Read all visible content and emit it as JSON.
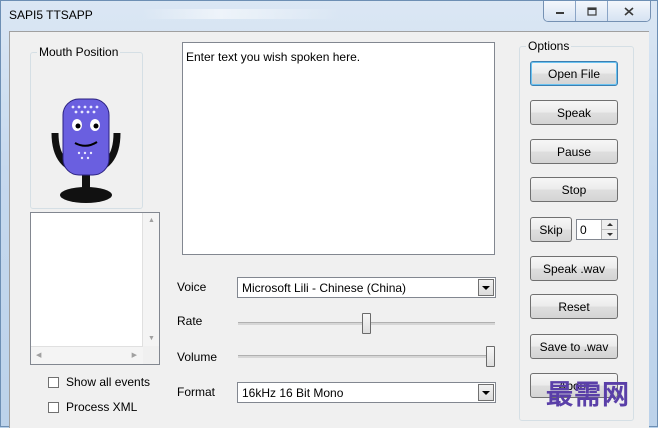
{
  "window": {
    "title": "SAPI5 TTSAPP"
  },
  "mouth_position": {
    "legend": "Mouth Position"
  },
  "text_input": {
    "value": "Enter text you wish spoken here."
  },
  "events_panel": {
    "show_all_events": {
      "label": "Show all events",
      "checked": false
    },
    "process_xml": {
      "label": "Process XML",
      "checked": false
    }
  },
  "voice": {
    "label": "Voice",
    "selected": "Microsoft Lili - Chinese (China)"
  },
  "rate": {
    "label": "Rate",
    "level": 0.5
  },
  "volume": {
    "label": "Volume",
    "level": 1.0
  },
  "format": {
    "label": "Format",
    "selected": "16kHz 16 Bit Mono"
  },
  "options": {
    "legend": "Options",
    "open_file": "Open File",
    "speak": "Speak",
    "pause": "Pause",
    "stop": "Stop",
    "skip": "Skip",
    "skip_value": "0",
    "speak_wav": "Speak .wav",
    "reset": "Reset",
    "save_to_wav": "Save to .wav",
    "about": "About"
  },
  "watermark": "最需网",
  "colors": {
    "mouth_face": "#6a5fe0",
    "watermark": "#5a3fa8"
  }
}
